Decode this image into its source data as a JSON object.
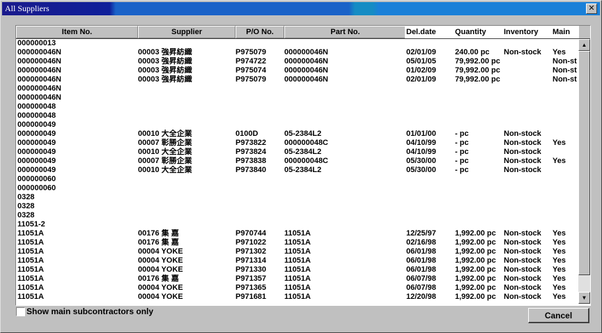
{
  "window": {
    "title": "All Suppliers",
    "close_glyph": "✕"
  },
  "columns": {
    "item": "Item No.",
    "supplier": "Supplier",
    "po": "P/O No.",
    "part": "Part No.",
    "del": "Del.date",
    "qty": "Quantity",
    "inv": "Inventory",
    "main": "Main"
  },
  "rows": [
    [
      "000000013",
      "",
      "",
      "",
      "",
      "",
      "",
      ""
    ],
    [
      "000000046N",
      "00003 強昇紡織",
      "P975079",
      "000000046N",
      "02/01/09",
      "240.00 pc",
      "Non-stock",
      "Yes"
    ],
    [
      "000000046N",
      "00003 強昇紡織",
      "P974722",
      "000000046N",
      "05/01/05",
      "79,992.00 pc",
      "",
      "Non-st"
    ],
    [
      "000000046N",
      "00003 強昇紡織",
      "P975074",
      "000000046N",
      "01/02/09",
      "79,992.00 pc",
      "",
      "Non-st"
    ],
    [
      "000000046N",
      "00003 強昇紡織",
      "P975079",
      "000000046N",
      "02/01/09",
      "79,992.00 pc",
      "",
      "Non-st"
    ],
    [
      "000000046N",
      "",
      "",
      "",
      "",
      "",
      "",
      ""
    ],
    [
      "000000046N",
      "",
      "",
      "",
      "",
      "",
      "",
      ""
    ],
    [
      "000000048",
      "",
      "",
      "",
      "",
      "",
      "",
      ""
    ],
    [
      "000000048",
      "",
      "",
      "",
      "",
      "",
      "",
      ""
    ],
    [
      "000000049",
      "",
      "",
      "",
      "",
      "",
      "",
      ""
    ],
    [
      "000000049",
      "00010 大全企業",
      "0100D",
      "05-2384L2",
      "01/01/00",
      "- pc",
      "Non-stock",
      ""
    ],
    [
      "000000049",
      "00007 彰勝企業",
      "P973822",
      "000000048C",
      "04/10/99",
      "- pc",
      "Non-stock",
      "Yes"
    ],
    [
      "000000049",
      "00010 大全企業",
      "P973824",
      "05-2384L2",
      "04/10/99",
      "- pc",
      "Non-stock",
      ""
    ],
    [
      "000000049",
      "00007 彰勝企業",
      "P973838",
      "000000048C",
      "05/30/00",
      "- pc",
      "Non-stock",
      "Yes"
    ],
    [
      "000000049",
      "00010 大全企業",
      "P973840",
      "05-2384L2",
      "05/30/00",
      "- pc",
      "Non-stock",
      ""
    ],
    [
      "000000060",
      "",
      "",
      "",
      "",
      "",
      "",
      ""
    ],
    [
      "000000060",
      "",
      "",
      "",
      "",
      "",
      "",
      ""
    ],
    [
      "0328",
      "",
      "",
      "",
      "",
      "",
      "",
      ""
    ],
    [
      "0328",
      "",
      "",
      "",
      "",
      "",
      "",
      ""
    ],
    [
      "0328",
      "",
      "",
      "",
      "",
      "",
      "",
      ""
    ],
    [
      "11051-2",
      "",
      "",
      "",
      "",
      "",
      "",
      ""
    ],
    [
      "11051A",
      "00176 集 嘉",
      "P970744",
      "11051A",
      "12/25/97",
      "1,992.00 pc",
      "Non-stock",
      "Yes"
    ],
    [
      "11051A",
      "00176 集 嘉",
      "P971022",
      "11051A",
      "02/16/98",
      "1,992.00 pc",
      "Non-stock",
      "Yes"
    ],
    [
      "11051A",
      "00004 YOKE",
      "P971302",
      "11051A",
      "06/01/98",
      "1,992.00 pc",
      "Non-stock",
      "Yes"
    ],
    [
      "11051A",
      "00004 YOKE",
      "P971314",
      "11051A",
      "06/01/98",
      "1,992.00 pc",
      "Non-stock",
      "Yes"
    ],
    [
      "11051A",
      "00004 YOKE",
      "P971330",
      "11051A",
      "06/01/98",
      "1,992.00 pc",
      "Non-stock",
      "Yes"
    ],
    [
      "11051A",
      "00176 集 嘉",
      "P971357",
      "11051A",
      "06/07/98",
      "1,992.00 pc",
      "Non-stock",
      "Yes"
    ],
    [
      "11051A",
      "00004 YOKE",
      "P971365",
      "11051A",
      "06/07/98",
      "1,992.00 pc",
      "Non-stock",
      "Yes"
    ],
    [
      "11051A",
      "00004 YOKE",
      "P971681",
      "11051A",
      "12/20/98",
      "1,992.00 pc",
      "Non-stock",
      "Yes"
    ]
  ],
  "footer": {
    "checkbox_label": "Show main subcontractors only",
    "cancel_label": "Cancel"
  },
  "scrollbar": {
    "up_glyph": "▲",
    "down_glyph": "▼"
  }
}
